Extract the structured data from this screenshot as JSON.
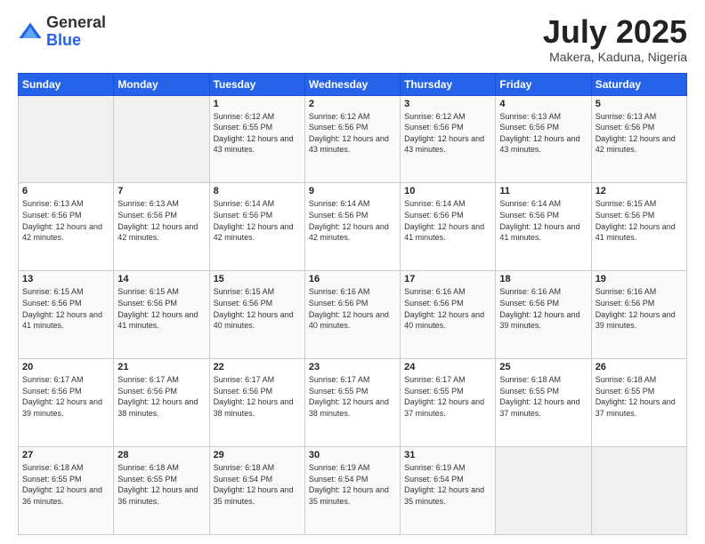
{
  "header": {
    "logo": {
      "general": "General",
      "blue": "Blue"
    },
    "title": "July 2025",
    "location": "Makera, Kaduna, Nigeria"
  },
  "weekdays": [
    "Sunday",
    "Monday",
    "Tuesday",
    "Wednesday",
    "Thursday",
    "Friday",
    "Saturday"
  ],
  "weeks": [
    [
      {
        "day": "",
        "info": ""
      },
      {
        "day": "",
        "info": ""
      },
      {
        "day": "1",
        "info": "Sunrise: 6:12 AM\nSunset: 6:55 PM\nDaylight: 12 hours and 43 minutes."
      },
      {
        "day": "2",
        "info": "Sunrise: 6:12 AM\nSunset: 6:56 PM\nDaylight: 12 hours and 43 minutes."
      },
      {
        "day": "3",
        "info": "Sunrise: 6:12 AM\nSunset: 6:56 PM\nDaylight: 12 hours and 43 minutes."
      },
      {
        "day": "4",
        "info": "Sunrise: 6:13 AM\nSunset: 6:56 PM\nDaylight: 12 hours and 43 minutes."
      },
      {
        "day": "5",
        "info": "Sunrise: 6:13 AM\nSunset: 6:56 PM\nDaylight: 12 hours and 42 minutes."
      }
    ],
    [
      {
        "day": "6",
        "info": "Sunrise: 6:13 AM\nSunset: 6:56 PM\nDaylight: 12 hours and 42 minutes."
      },
      {
        "day": "7",
        "info": "Sunrise: 6:13 AM\nSunset: 6:56 PM\nDaylight: 12 hours and 42 minutes."
      },
      {
        "day": "8",
        "info": "Sunrise: 6:14 AM\nSunset: 6:56 PM\nDaylight: 12 hours and 42 minutes."
      },
      {
        "day": "9",
        "info": "Sunrise: 6:14 AM\nSunset: 6:56 PM\nDaylight: 12 hours and 42 minutes."
      },
      {
        "day": "10",
        "info": "Sunrise: 6:14 AM\nSunset: 6:56 PM\nDaylight: 12 hours and 41 minutes."
      },
      {
        "day": "11",
        "info": "Sunrise: 6:14 AM\nSunset: 6:56 PM\nDaylight: 12 hours and 41 minutes."
      },
      {
        "day": "12",
        "info": "Sunrise: 6:15 AM\nSunset: 6:56 PM\nDaylight: 12 hours and 41 minutes."
      }
    ],
    [
      {
        "day": "13",
        "info": "Sunrise: 6:15 AM\nSunset: 6:56 PM\nDaylight: 12 hours and 41 minutes."
      },
      {
        "day": "14",
        "info": "Sunrise: 6:15 AM\nSunset: 6:56 PM\nDaylight: 12 hours and 41 minutes."
      },
      {
        "day": "15",
        "info": "Sunrise: 6:15 AM\nSunset: 6:56 PM\nDaylight: 12 hours and 40 minutes."
      },
      {
        "day": "16",
        "info": "Sunrise: 6:16 AM\nSunset: 6:56 PM\nDaylight: 12 hours and 40 minutes."
      },
      {
        "day": "17",
        "info": "Sunrise: 6:16 AM\nSunset: 6:56 PM\nDaylight: 12 hours and 40 minutes."
      },
      {
        "day": "18",
        "info": "Sunrise: 6:16 AM\nSunset: 6:56 PM\nDaylight: 12 hours and 39 minutes."
      },
      {
        "day": "19",
        "info": "Sunrise: 6:16 AM\nSunset: 6:56 PM\nDaylight: 12 hours and 39 minutes."
      }
    ],
    [
      {
        "day": "20",
        "info": "Sunrise: 6:17 AM\nSunset: 6:56 PM\nDaylight: 12 hours and 39 minutes."
      },
      {
        "day": "21",
        "info": "Sunrise: 6:17 AM\nSunset: 6:56 PM\nDaylight: 12 hours and 38 minutes."
      },
      {
        "day": "22",
        "info": "Sunrise: 6:17 AM\nSunset: 6:56 PM\nDaylight: 12 hours and 38 minutes."
      },
      {
        "day": "23",
        "info": "Sunrise: 6:17 AM\nSunset: 6:55 PM\nDaylight: 12 hours and 38 minutes."
      },
      {
        "day": "24",
        "info": "Sunrise: 6:17 AM\nSunset: 6:55 PM\nDaylight: 12 hours and 37 minutes."
      },
      {
        "day": "25",
        "info": "Sunrise: 6:18 AM\nSunset: 6:55 PM\nDaylight: 12 hours and 37 minutes."
      },
      {
        "day": "26",
        "info": "Sunrise: 6:18 AM\nSunset: 6:55 PM\nDaylight: 12 hours and 37 minutes."
      }
    ],
    [
      {
        "day": "27",
        "info": "Sunrise: 6:18 AM\nSunset: 6:55 PM\nDaylight: 12 hours and 36 minutes."
      },
      {
        "day": "28",
        "info": "Sunrise: 6:18 AM\nSunset: 6:55 PM\nDaylight: 12 hours and 36 minutes."
      },
      {
        "day": "29",
        "info": "Sunrise: 6:18 AM\nSunset: 6:54 PM\nDaylight: 12 hours and 35 minutes."
      },
      {
        "day": "30",
        "info": "Sunrise: 6:19 AM\nSunset: 6:54 PM\nDaylight: 12 hours and 35 minutes."
      },
      {
        "day": "31",
        "info": "Sunrise: 6:19 AM\nSunset: 6:54 PM\nDaylight: 12 hours and 35 minutes."
      },
      {
        "day": "",
        "info": ""
      },
      {
        "day": "",
        "info": ""
      }
    ]
  ]
}
